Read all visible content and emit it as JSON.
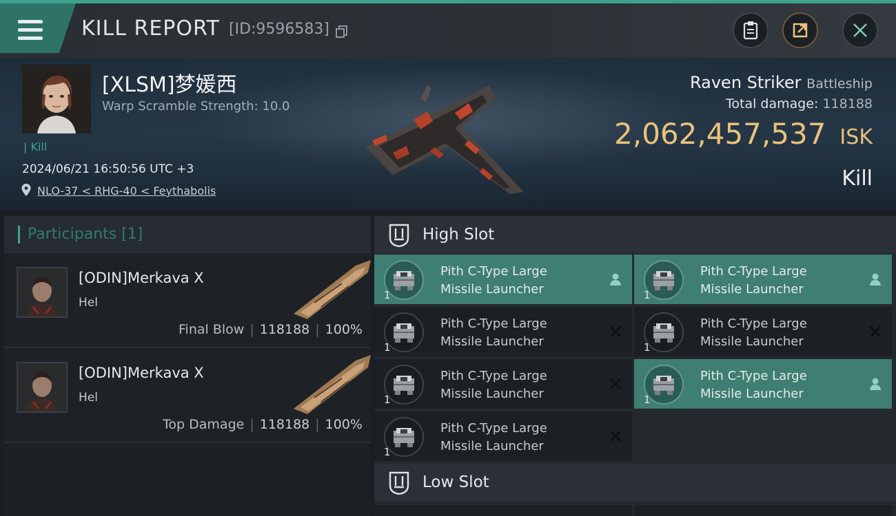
{
  "header": {
    "title": "KILL REPORT",
    "id_text": "[ID:9596583]"
  },
  "victim": {
    "name": "[XLSM]梦媛西",
    "stat": "Warp Scramble Strength: 10.0",
    "tag": "Kill",
    "datetime": "2024/06/21 16:50:56 UTC +3",
    "location": "NLO-37 < RHG-40 < Feythabolis",
    "ship_name": "Raven Striker",
    "ship_class": "Battleship",
    "total_damage_label": "Total damage:",
    "total_damage_value": "118188",
    "isk_value": "2,062,457,537",
    "isk_unit": "ISK",
    "outcome": "Kill"
  },
  "participants": {
    "title": "Participants [1]",
    "rows": [
      {
        "name": "[ODIN]Merkava X",
        "ship": "Hel",
        "label": "Final Blow",
        "damage": "118188",
        "percent": "100%"
      },
      {
        "name": "[ODIN]Merkava X",
        "ship": "Hel",
        "label": "Top Damage",
        "damage": "118188",
        "percent": "100%"
      }
    ]
  },
  "slots": {
    "high_title": "High Slot",
    "low_title": "Low Slot",
    "high_modules": [
      {
        "name": "Pith C-Type Large Missile Launcher",
        "qty": "1",
        "status": "pilot-icon",
        "active": true
      },
      {
        "name": "Pith C-Type Large Missile Launcher",
        "qty": "1",
        "status": "pilot-icon",
        "active": true
      },
      {
        "name": "Pith C-Type Large Missile Launcher",
        "qty": "1",
        "status": "close-icon",
        "active": false
      },
      {
        "name": "Pith C-Type Large Missile Launcher",
        "qty": "1",
        "status": "close-icon",
        "active": false
      },
      {
        "name": "Pith C-Type Large Missile Launcher",
        "qty": "1",
        "status": "close-icon",
        "active": false
      },
      {
        "name": "Pith C-Type Large Missile Launcher",
        "qty": "1",
        "status": "pilot-icon",
        "active": true
      },
      {
        "name": "Pith C-Type Large Missile Launcher",
        "qty": "1",
        "status": "close-icon",
        "active": false
      }
    ]
  },
  "colors": {
    "accent": "#3fa08c",
    "isk": "#e9c27a",
    "active_module": "#3f7e72"
  }
}
